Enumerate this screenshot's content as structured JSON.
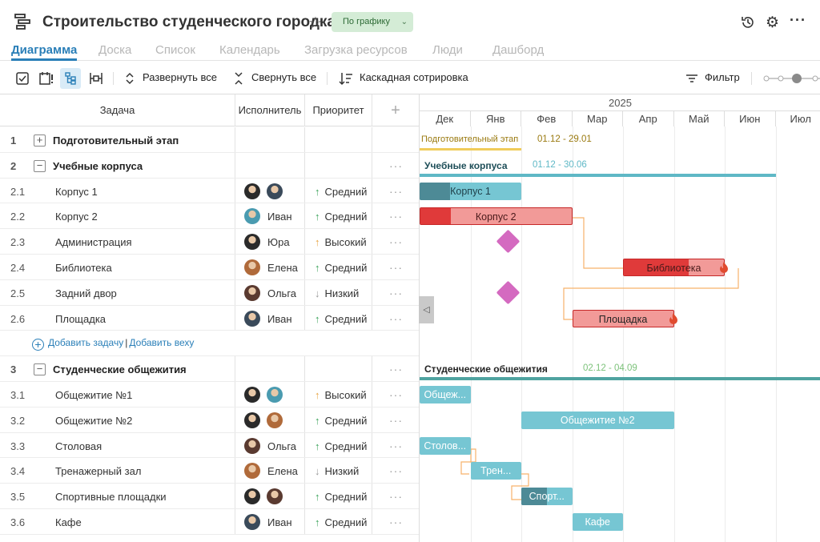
{
  "header": {
    "title": "Строительство студенческого городка",
    "status": "По графику"
  },
  "tabs": [
    "Диаграмма",
    "Доска",
    "Список",
    "Календарь",
    "Загрузка ресурсов",
    "Люди",
    "Дашборд"
  ],
  "toolbar": {
    "expand_all": "Развернуть все",
    "collapse_all": "Свернуть все",
    "cascade_sort": "Каскадная сотрировка",
    "filter": "Фильтр"
  },
  "grid": {
    "col_task": "Задача",
    "col_assignee": "Исполнитель",
    "col_priority": "Приоритет",
    "add_col": "+",
    "add_task": "Добавить задачу",
    "add_milestone": "Добавить веху",
    "link_sep": "|",
    "rows": [
      {
        "num": "1",
        "name": "Подготовительный этап",
        "group": true,
        "expander": "+"
      },
      {
        "num": "2",
        "name": "Учебные корпуса",
        "group": true,
        "expander": "−",
        "more": "···"
      },
      {
        "num": "2.1",
        "name": "Корпус 1",
        "avatars": [
          "#2a2a2a",
          "#3a4a5a"
        ],
        "assignee": "",
        "prio": "Средний",
        "prio_arrow": "↑",
        "more": "···"
      },
      {
        "num": "2.2",
        "name": "Корпус 2",
        "avatars": [
          "#4a9bb0"
        ],
        "assignee": "Иван",
        "prio": "Средний",
        "prio_arrow": "↑",
        "more": "···"
      },
      {
        "num": "2.3",
        "name": "Администрация",
        "avatars": [
          "#2a2a2a"
        ],
        "assignee": "Юра",
        "prio": "Высокий",
        "prio_arrow": "↑",
        "more": "···"
      },
      {
        "num": "2.4",
        "name": "Библиотека",
        "avatars": [
          "#b06a3a"
        ],
        "assignee": "Елена",
        "prio": "Средний",
        "prio_arrow": "↑",
        "more": "···"
      },
      {
        "num": "2.5",
        "name": "Задний двор",
        "avatars": [
          "#5a3a30"
        ],
        "assignee": "Ольга",
        "prio": "Низкий",
        "prio_arrow": "↓",
        "more": "···"
      },
      {
        "num": "2.6",
        "name": "Площадка",
        "avatars": [
          "#3a4a5a"
        ],
        "assignee": "Иван",
        "prio": "Средний",
        "prio_arrow": "↑",
        "more": "···"
      },
      {
        "addrow": true
      },
      {
        "num": "3",
        "name": "Студенческие общежития",
        "group": true,
        "expander": "−",
        "more": "···"
      },
      {
        "num": "3.1",
        "name": "Общежитие №1",
        "avatars": [
          "#2a2a2a",
          "#4a9bb0"
        ],
        "assignee": "",
        "prio": "Высокий",
        "prio_arrow": "↑",
        "more": "···"
      },
      {
        "num": "3.2",
        "name": "Общежитие №2",
        "avatars": [
          "#2a2a2a",
          "#b06a3a"
        ],
        "assignee": "",
        "prio": "Средний",
        "prio_arrow": "↑",
        "more": "···"
      },
      {
        "num": "3.3",
        "name": "Столовая",
        "avatars": [
          "#5a3a30"
        ],
        "assignee": "Ольга",
        "prio": "Средний",
        "prio_arrow": "↑",
        "more": "···"
      },
      {
        "num": "3.4",
        "name": "Тренажерный зал",
        "avatars": [
          "#b06a3a"
        ],
        "assignee": "Елена",
        "prio": "Низкий",
        "prio_arrow": "↓",
        "more": "···"
      },
      {
        "num": "3.5",
        "name": "Спортивные площадки",
        "avatars": [
          "#2a2a2a",
          "#5a3a30"
        ],
        "assignee": "",
        "prio": "Средний",
        "prio_arrow": "↑",
        "more": "···"
      },
      {
        "num": "3.6",
        "name": "Кафе",
        "avatars": [
          "#3a4a5a"
        ],
        "assignee": "Иван",
        "prio": "Средний",
        "prio_arrow": "↑",
        "more": "···"
      }
    ]
  },
  "timeline": {
    "year": "2025",
    "months": [
      "Дек",
      "Янв",
      "Фев",
      "Мар",
      "Апр",
      "Май",
      "Июн",
      "Июл"
    ],
    "bars": [
      {
        "row": 0,
        "kind": "summary-label",
        "label": "Подготовительный этап",
        "dates": "01.12 - 29.01",
        "start": 0,
        "end": 2,
        "color": "#f0cc5a",
        "text_color": "#9a7a10"
      },
      {
        "row": 1,
        "kind": "summary",
        "label": "Учебные корпуса",
        "dates": "01.12 - 30.06",
        "start": 0,
        "end": 7,
        "color": "#5fb8c6",
        "text_color": "#1e4e58"
      },
      {
        "row": 2,
        "kind": "task",
        "label": "Корпус 1",
        "start": 0,
        "end": 2,
        "progress": 0.3,
        "color": "#76c6d3",
        "pcolor": "#4d8a96",
        "text_color": "#1e3e48"
      },
      {
        "row": 3,
        "kind": "task",
        "label": "Корпус 2",
        "start": 0,
        "end": 3,
        "progress": 0.2,
        "color": "#f29a98",
        "pcolor": "#e03a3a",
        "border": "#c62828",
        "text_color": "#4a1a1a"
      },
      {
        "row": 4,
        "kind": "milestone",
        "start": 1
      },
      {
        "row": 5,
        "kind": "task",
        "label": "Библиотека",
        "start": 4,
        "end": 6,
        "progress": 0.65,
        "color": "#f29a98",
        "pcolor": "#e03a3a",
        "border": "#c62828",
        "text_color": "#4a1a1a",
        "fire": true
      },
      {
        "row": 6,
        "kind": "milestone",
        "start": 1
      },
      {
        "row": 7,
        "kind": "task",
        "label": "Площадка",
        "start": 3,
        "end": 5,
        "progress": 0,
        "color": "#f29a98",
        "pcolor": "#e03a3a",
        "border": "#c62828",
        "text_color": "#222",
        "fire": true
      },
      {
        "row": 9,
        "kind": "summary",
        "label": "Студенческие общежития",
        "dates": "02.12 - 04.09",
        "start": 0,
        "end": 8,
        "color": "#4fa3a0",
        "text_color": "#222",
        "dates_color": "#7cc27a"
      },
      {
        "row": 10,
        "kind": "task",
        "label": "Общеж...",
        "start": 0,
        "end": 1,
        "progress": 0,
        "color": "#76c6d3",
        "text_color": "#fff"
      },
      {
        "row": 11,
        "kind": "task",
        "label": "Общежитие №2",
        "start": 2,
        "end": 5,
        "progress": 0,
        "color": "#76c6d3",
        "text_color": "#fff"
      },
      {
        "row": 12,
        "kind": "task",
        "label": "Столов...",
        "start": 0,
        "end": 1,
        "progress": 0,
        "color": "#76c6d3",
        "text_color": "#fff"
      },
      {
        "row": 13,
        "kind": "task",
        "label": "Трен...",
        "start": 1,
        "end": 2,
        "progress": 0,
        "color": "#76c6d3",
        "text_color": "#fff"
      },
      {
        "row": 14,
        "kind": "task",
        "label": "Спорт...",
        "start": 2,
        "end": 3,
        "progress": 0.5,
        "color": "#76c6d3",
        "pcolor": "#4d8a96",
        "text_color": "#fff"
      },
      {
        "row": 15,
        "kind": "task",
        "label": "Кафе",
        "start": 3,
        "end": 4,
        "progress": 0,
        "color": "#76c6d3",
        "text_color": "#fff"
      }
    ]
  },
  "icons": {
    "star": "☆",
    "history": "⟲",
    "settings": "⚙",
    "more": "···",
    "expand": "⌃⌄",
    "collapse": "✕",
    "sort": "↓",
    "filter": "☰",
    "collapse_panel": "◁",
    "fire": "🔥"
  },
  "colors": {
    "accent": "#2a7fb8",
    "status_bg": "#d4ecd6",
    "link_line": "#f6b26b"
  }
}
